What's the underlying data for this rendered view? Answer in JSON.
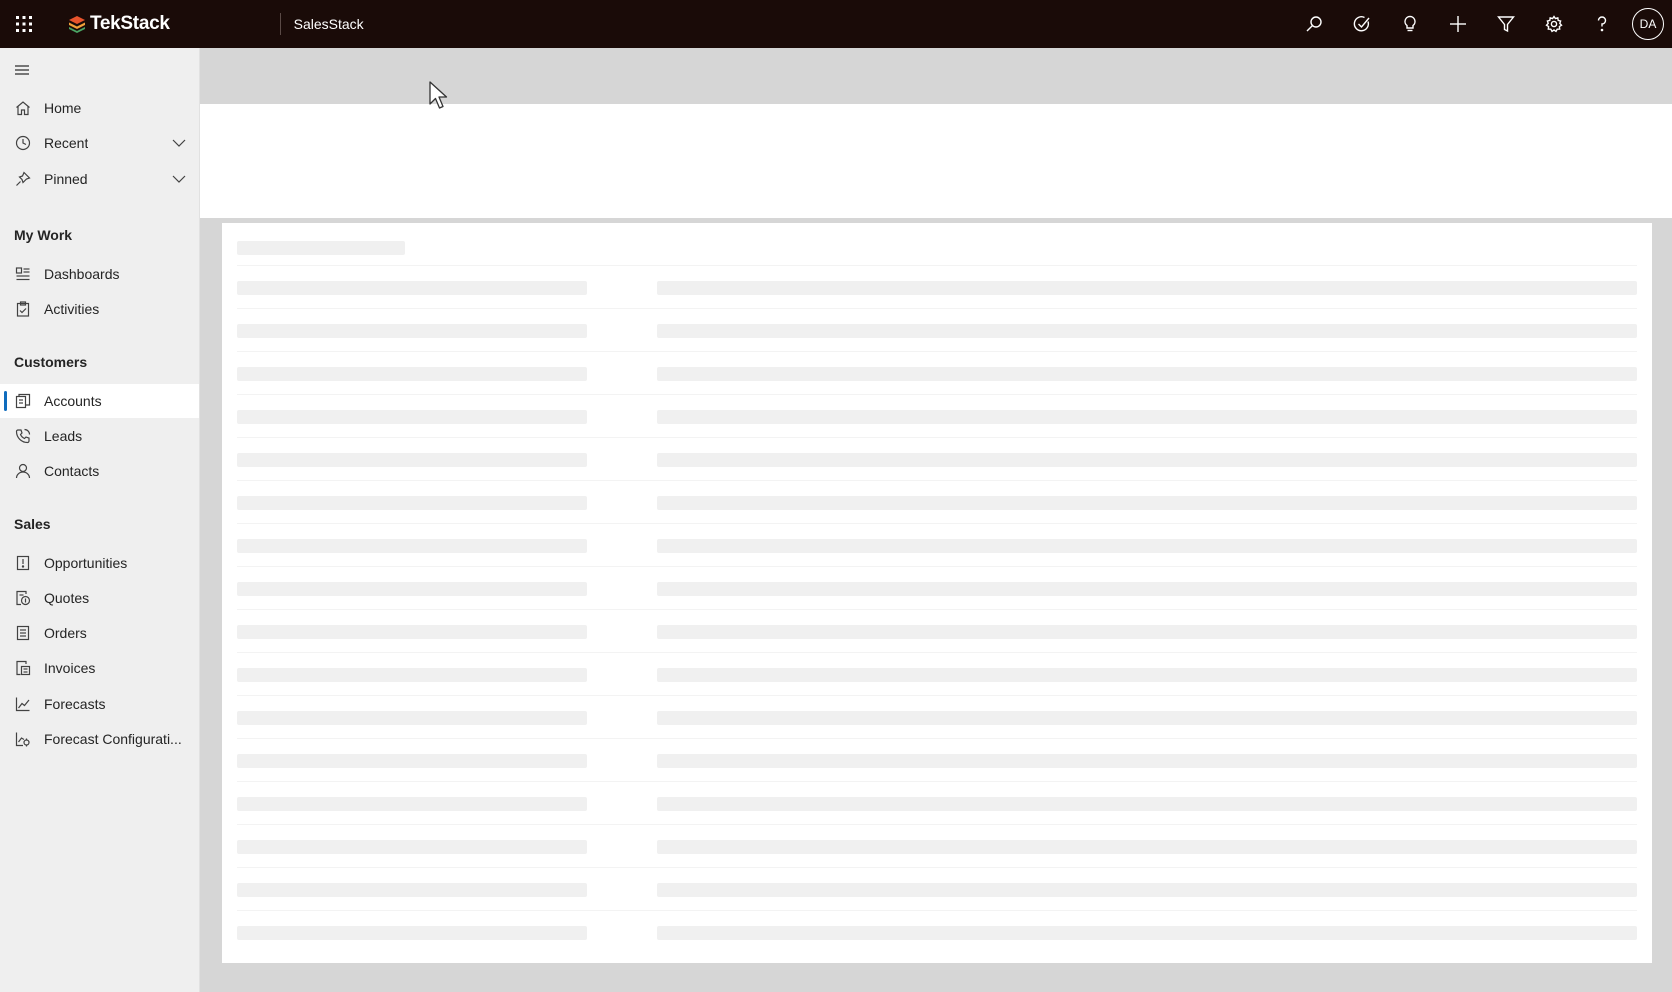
{
  "topbar": {
    "brand": "TekStack",
    "app_name": "SalesStack",
    "avatar_initials": "DA",
    "icons": [
      "search-icon",
      "task-check-icon",
      "lightbulb-icon",
      "plus-icon",
      "filter-icon",
      "gear-icon",
      "help-icon"
    ]
  },
  "sidebar": {
    "top_items": [
      {
        "label": "Home",
        "icon": "home-icon"
      },
      {
        "label": "Recent",
        "icon": "clock-icon",
        "expandable": true
      },
      {
        "label": "Pinned",
        "icon": "pin-icon",
        "expandable": true
      }
    ],
    "sections": [
      {
        "title": "My Work",
        "items": [
          {
            "label": "Dashboards",
            "icon": "dashboard-icon"
          },
          {
            "label": "Activities",
            "icon": "clipboard-icon"
          }
        ]
      },
      {
        "title": "Customers",
        "items": [
          {
            "label": "Accounts",
            "icon": "building-icon",
            "active": true
          },
          {
            "label": "Leads",
            "icon": "phone-icon"
          },
          {
            "label": "Contacts",
            "icon": "person-icon"
          }
        ]
      },
      {
        "title": "Sales",
        "items": [
          {
            "label": "Opportunities",
            "icon": "opportunity-icon"
          },
          {
            "label": "Quotes",
            "icon": "quote-icon"
          },
          {
            "label": "Orders",
            "icon": "order-icon"
          },
          {
            "label": "Invoices",
            "icon": "invoice-icon"
          },
          {
            "label": "Forecasts",
            "icon": "chart-line-icon"
          },
          {
            "label": "Forecast Configurati...",
            "icon": "forecast-config-icon"
          }
        ]
      }
    ]
  },
  "main": {
    "state": "loading",
    "skeleton_rows": 16
  },
  "colors": {
    "topbar_bg": "#1a0b08",
    "sidebar_bg": "#efefef",
    "accent": "#0f6cbd",
    "canvas_bg": "#d6d6d6",
    "skeleton": "#f0f0f0"
  }
}
